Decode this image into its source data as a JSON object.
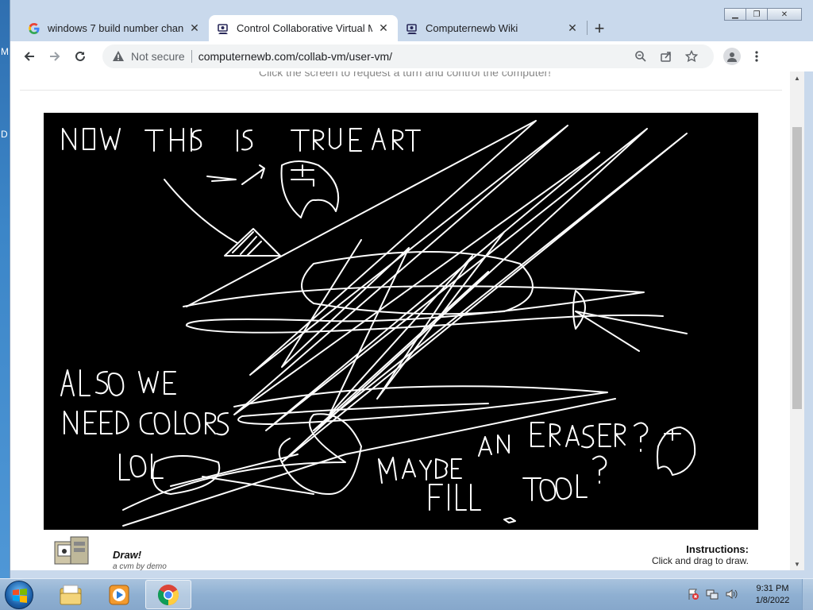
{
  "desktop": {
    "edge_letters": [
      "M",
      "D"
    ]
  },
  "tabs": [
    {
      "title": "windows 7 build number change",
      "icon": "google-g-icon",
      "active": false
    },
    {
      "title": "Control Collaborative Virtual Ma",
      "icon": "collabvm-icon",
      "active": true
    },
    {
      "title": "Computernewb Wiki",
      "icon": "collabvm-icon",
      "active": false
    }
  ],
  "omnibox": {
    "security_label": "Not secure",
    "url": "computernewb.com/collab-vm/user-vm/"
  },
  "page": {
    "hint": "Click the screen to request a turn and control the computer!",
    "vm_drawing_text": [
      "NOW THIS IS TRUE ART",
      "ALSO WE NEED COLORS LOL",
      "MAYBE AN ERASER? FILL TOOL?"
    ],
    "app_name": "Draw!",
    "app_author": "a cvm by demo",
    "instructions_title": "Instructions:",
    "instructions_text": "Click and drag to draw."
  },
  "taskbar": {
    "apps": [
      "explorer-icon",
      "media-player-icon",
      "chrome-icon"
    ],
    "clock_time": "9:31 PM",
    "clock_date": "1/8/2022"
  },
  "colors": {
    "accent": "#1a73e8",
    "taskbar": "#8fb0d2",
    "vm_background": "#000000"
  }
}
